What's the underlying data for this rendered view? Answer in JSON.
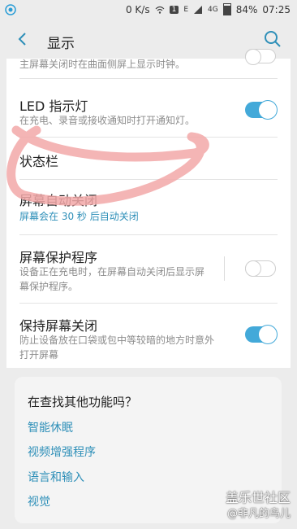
{
  "status_bar": {
    "network_speed": "0 K/s",
    "notification_badge": "1",
    "signal_type": "4G",
    "battery": "84%",
    "time": "07:25",
    "icons": [
      "carrier-icon",
      "wifi-icon",
      "nfc-icon",
      "e-signal-icon",
      "signal-icon",
      "battery-icon"
    ]
  },
  "header": {
    "title": "显示",
    "back_icon": "back-arrow-icon",
    "search_icon": "search-icon"
  },
  "settings": {
    "partial_item_sub": "主屏幕关闭时在曲面侧屏上显示时钟。",
    "led": {
      "title": "LED 指示灯",
      "subtitle": "在充电、录音或接收通知时打开通知灯。",
      "enabled": true
    },
    "status_bar": {
      "title": "状态栏"
    },
    "screen_timeout": {
      "title": "屏幕自动关闭",
      "subtitle": "屏幕会在 30 秒 后自动关闭"
    },
    "screensaver": {
      "title": "屏幕保护程序",
      "subtitle_line1": "设备正在充电时，在屏幕自动关闭后显示屏",
      "subtitle_line2": "幕保护程序。",
      "enabled": false
    },
    "keep_screen_off": {
      "title": "保持屏幕关闭",
      "subtitle_line1": "防止设备放在口袋或包中等较暗的地方时意外",
      "subtitle_line2": "打开屏幕",
      "enabled": true
    }
  },
  "suggestions": {
    "title": "在查找其他功能吗？",
    "links": [
      "智能休眠",
      "视频增强程序",
      "语言和输入",
      "视觉"
    ]
  },
  "watermark": {
    "line1": "盖乐世社区",
    "line2": "@非凡的鸟儿"
  },
  "colors": {
    "accent": "#43a9d9",
    "link": "#2e8fb8",
    "annotation": "#f2a8a8"
  }
}
